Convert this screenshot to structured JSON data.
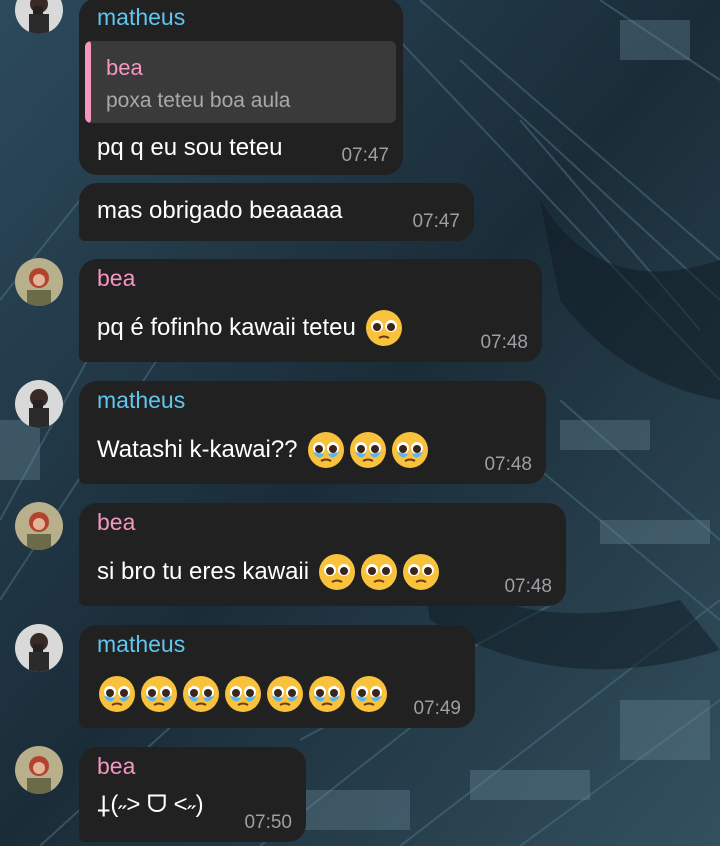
{
  "colors": {
    "bubble": "#212121",
    "matheus_name": "#5ec6ef",
    "bea_name": "#f497c0",
    "timestamp": "#9c9fa3",
    "reply_bg": "#3a3a3a"
  },
  "messages": [
    {
      "sender": "matheus",
      "reply": {
        "sender": "bea",
        "text": "poxa teteu boa aula"
      },
      "text": "pq q eu sou teteu",
      "time": "07:47"
    },
    {
      "sender": "matheus",
      "text": "mas obrigado beaaaaa",
      "time": "07:47"
    },
    {
      "sender": "bea",
      "text": "pq é fofinho kawaii teteu",
      "emoji": [
        "pleading-face-emoji"
      ],
      "time": "07:48"
    },
    {
      "sender": "matheus",
      "text": "Watashi k-kawai??",
      "emoji": [
        "crying-pleading-face-emoji",
        "crying-pleading-face-emoji",
        "crying-pleading-face-emoji"
      ],
      "time": "07:48"
    },
    {
      "sender": "bea",
      "text": "si bro tu eres kawaii",
      "emoji": [
        "pleading-face-emoji",
        "pleading-face-emoji",
        "pleading-face-emoji"
      ],
      "time": "07:48"
    },
    {
      "sender": "matheus",
      "text": "",
      "emoji": [
        "crying-pleading-face-emoji",
        "crying-pleading-face-emoji",
        "crying-pleading-face-emoji",
        "crying-pleading-face-emoji",
        "crying-pleading-face-emoji",
        "crying-pleading-face-emoji",
        "crying-pleading-face-emoji"
      ],
      "time": "07:49"
    },
    {
      "sender": "bea",
      "text": "⸸(˶> ᗜ <˶)",
      "time": "07:50"
    }
  ]
}
